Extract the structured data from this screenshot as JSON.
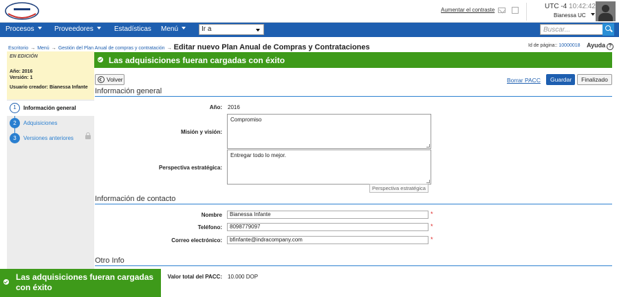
{
  "header": {
    "logo_text": "COMPRAS DOMINICANAS",
    "contrast_link": "Aumentar el contraste",
    "timezone": "UTC -4",
    "time": "10:42:42",
    "user_name": "Bianessa UC"
  },
  "nav": {
    "items": [
      {
        "label": "Procesos"
      },
      {
        "label": "Proveedores"
      },
      {
        "label": "Estadísticas"
      },
      {
        "label": "Menú"
      }
    ],
    "goto_value": "Ir a",
    "search_placeholder": "Buscar..."
  },
  "breadcrumb": {
    "items": [
      "Escritorio",
      "Menú",
      "Gestión del Plan Anual de compras y contratación"
    ],
    "current": "Editar nuevo Plan Anual de Compras y Contrataciones"
  },
  "page_meta": {
    "id_label": "Id de página::",
    "id_value": "10000018",
    "help_label": "Ayuda",
    "help_icon": "?"
  },
  "sidebar": {
    "status": "EN EDICIÓN",
    "year_line": "Año: 2016",
    "version_line": "Versión: 1",
    "creator_line": "Usuario creador: Bianessa Infante",
    "steps": [
      {
        "num": "1",
        "label": "Información general"
      },
      {
        "num": "2",
        "label": "Adquisiciones"
      },
      {
        "num": "3",
        "label": "Versiones anteriores"
      }
    ]
  },
  "banner": {
    "message": "Las adquisiciones fueran cargadas con éxito"
  },
  "toolbar": {
    "back_label": "Volver",
    "clear_label": "Borrar PACC",
    "save_label": "Guardar",
    "finalize_label": "Finalizado"
  },
  "general": {
    "title": "Información general",
    "year_label": "Año:",
    "year_value": "2016",
    "mission_label": "Misión y visión:",
    "mission_value": "Compromiso",
    "perspective_label": "Perspectiva estratégica:",
    "perspective_value": "Entregar todo lo mejor.",
    "perspective_tooltip": "Perspectiva estratégica"
  },
  "contact": {
    "title": "Información de contacto",
    "name_label": "Nombre",
    "name_value": "Bianessa Infante",
    "phone_label": "Teléfono:",
    "phone_value": "8098779097",
    "email_label": "Correo electrónico:",
    "email_value": "bfinfante@indracompany.com",
    "required_mark": "*"
  },
  "other": {
    "title": "Otro Info",
    "total_label": "Valor total del PACC:",
    "total_value": "10.000 DOP"
  },
  "toast": {
    "message": "Las adquisiciones fueran cargadas con éxito"
  },
  "colors": {
    "nav_blue": "#1e5fb0",
    "success_green": "#3e9a1a",
    "edit_yellow": "#fcf5c8"
  }
}
